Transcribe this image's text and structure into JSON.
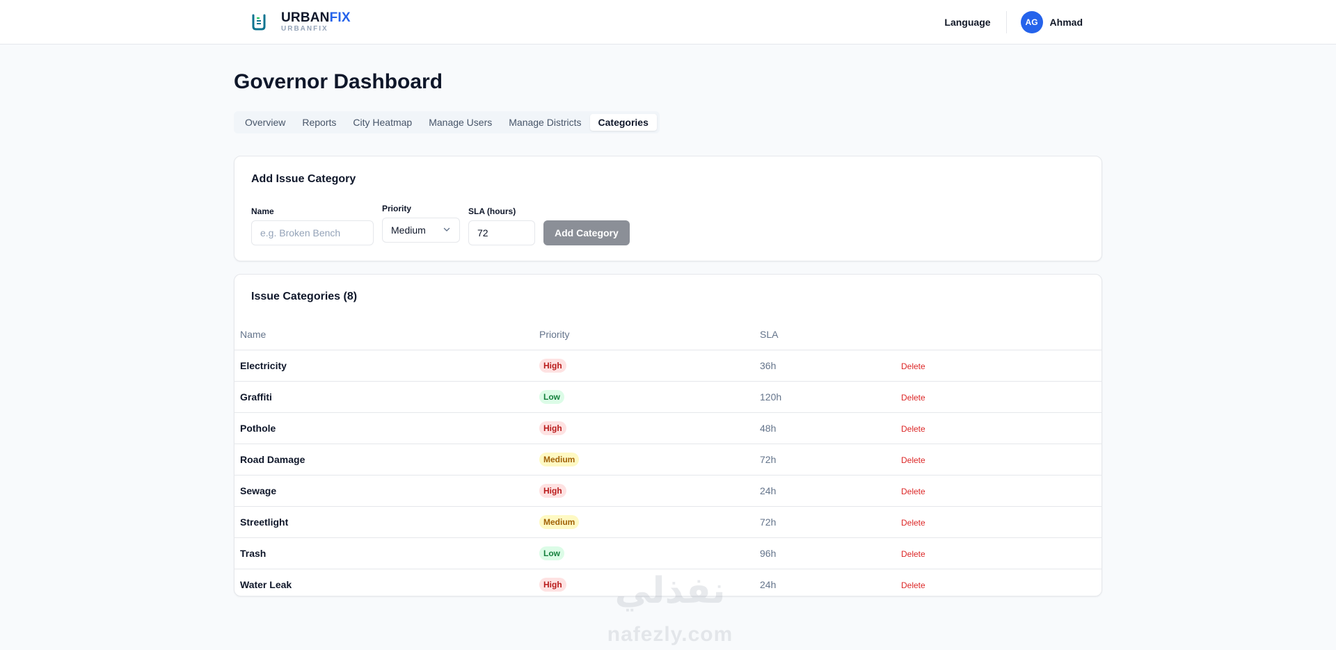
{
  "header": {
    "brand": {
      "name_part1": "URBAN",
      "name_part2": "FIX",
      "subtitle": "URBANFIX"
    },
    "language_label": "Language",
    "user": {
      "initials": "AG",
      "name": "Ahmad"
    }
  },
  "page": {
    "title": "Governor Dashboard",
    "tabs": [
      {
        "label": "Overview",
        "active": false
      },
      {
        "label": "Reports",
        "active": false
      },
      {
        "label": "City Heatmap",
        "active": false
      },
      {
        "label": "Manage Users",
        "active": false
      },
      {
        "label": "Manage Districts",
        "active": false
      },
      {
        "label": "Categories",
        "active": true
      }
    ]
  },
  "add_form": {
    "title": "Add Issue Category",
    "name_label": "Name",
    "name_placeholder": "e.g. Broken Bench",
    "priority_label": "Priority",
    "priority_value": "Medium",
    "sla_label": "SLA (hours)",
    "sla_value": "72",
    "submit_label": "Add Category"
  },
  "list": {
    "title": "Issue Categories (8)",
    "columns": {
      "name": "Name",
      "priority": "Priority",
      "sla": "SLA"
    },
    "delete_label": "Delete",
    "rows": [
      {
        "name": "Electricity",
        "priority": "High",
        "sla": "36h"
      },
      {
        "name": "Graffiti",
        "priority": "Low",
        "sla": "120h"
      },
      {
        "name": "Pothole",
        "priority": "High",
        "sla": "48h"
      },
      {
        "name": "Road Damage",
        "priority": "Medium",
        "sla": "72h"
      },
      {
        "name": "Sewage",
        "priority": "High",
        "sla": "24h"
      },
      {
        "name": "Streetlight",
        "priority": "Medium",
        "sla": "72h"
      },
      {
        "name": "Trash",
        "priority": "Low",
        "sla": "96h"
      },
      {
        "name": "Water Leak",
        "priority": "High",
        "sla": "24h"
      }
    ]
  },
  "watermark": {
    "arabic": "نفذلي",
    "latin": "nafezly.com"
  },
  "colors": {
    "accent": "#2563eb",
    "high_bg": "#fee2e2",
    "high_text": "#b91c1c",
    "low_bg": "#dcfce7",
    "low_text": "#15803d",
    "medium_bg": "#fef9c3",
    "medium_text": "#a16207",
    "delete": "#dc2626",
    "button_disabled": "#8b8f97"
  },
  "icons": {
    "logo": "urbanfix-logo-icon",
    "select": "chevron-down-icon"
  }
}
